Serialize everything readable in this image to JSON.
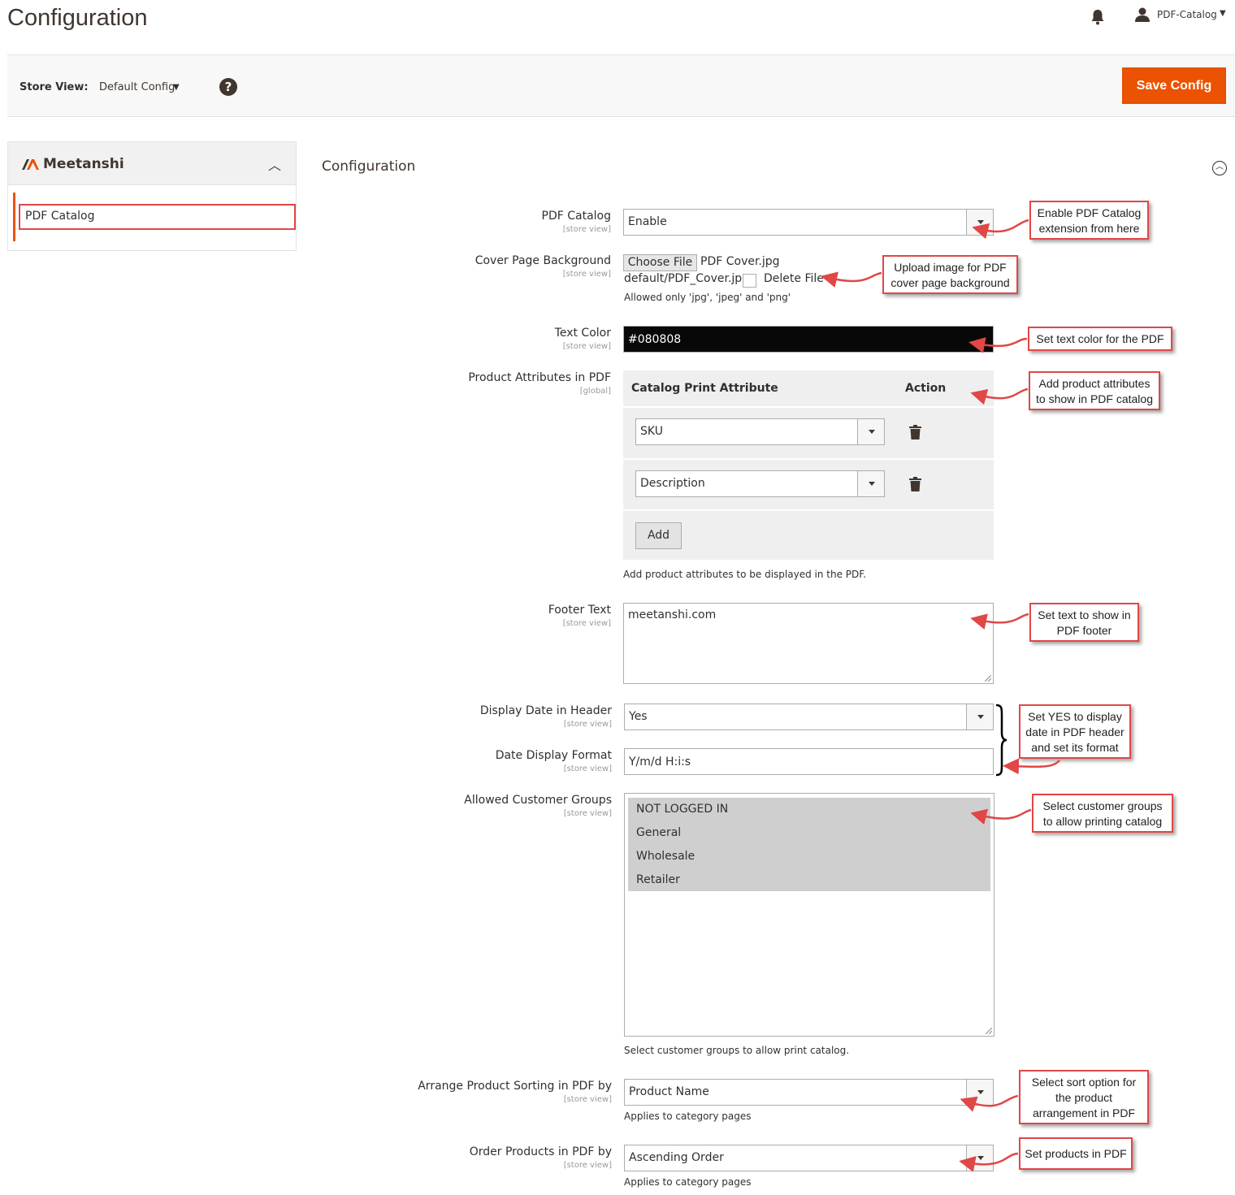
{
  "header": {
    "title": "Configuration",
    "user_name": "PDF-Catalog",
    "icons": [
      "bell-icon",
      "user-icon"
    ]
  },
  "store_bar": {
    "label": "Store View:",
    "value": "Default Config",
    "help": "?",
    "save_label": "Save Config"
  },
  "sidebar": {
    "brand": "Meetanshi",
    "items": [
      {
        "label": "PDF Catalog"
      }
    ]
  },
  "section": {
    "title": "Configuration"
  },
  "fields": {
    "pdf_catalog": {
      "label": "PDF Catalog",
      "scope": "[store view]",
      "value": "Enable"
    },
    "cover_page": {
      "label": "Cover Page Background",
      "scope": "[store view]",
      "button": "Choose File",
      "file_name": "PDF Cover.jpg",
      "current_path": "default/PDF_Cover.jpg",
      "delete_label": "Delete File",
      "note": "Allowed only 'jpg', 'jpeg' and 'png'"
    },
    "text_color": {
      "label": "Text Color",
      "scope": "[store view]",
      "value": "#080808"
    },
    "attributes": {
      "label": "Product Attributes in PDF",
      "scope": "[global]",
      "col_attribute": "Catalog Print Attribute",
      "col_action": "Action",
      "rows": [
        {
          "value": "SKU"
        },
        {
          "value": "Description"
        }
      ],
      "add_label": "Add",
      "note": "Add product attributes to be displayed in the PDF."
    },
    "footer_text": {
      "label": "Footer Text",
      "scope": "[store view]",
      "value": "meetanshi.com"
    },
    "display_date": {
      "label": "Display Date in Header",
      "scope": "[store view]",
      "value": "Yes"
    },
    "date_format": {
      "label": "Date Display Format",
      "scope": "[store view]",
      "value": "Y/m/d H:i:s"
    },
    "customer_groups": {
      "label": "Allowed Customer Groups",
      "scope": "[store view]",
      "options": [
        "NOT LOGGED IN",
        "General",
        "Wholesale",
        "Retailer"
      ],
      "note": "Select customer groups to allow print catalog."
    },
    "sorting": {
      "label": "Arrange Product Sorting in PDF by",
      "scope": "[store view]",
      "value": "Product Name",
      "note": "Applies to category pages"
    },
    "order": {
      "label": "Order Products in PDF by",
      "scope": "[store view]",
      "value": "Ascending Order",
      "note": "Applies to category pages"
    }
  },
  "callouts": {
    "enable": [
      "Enable PDF Catalog",
      "extension from here"
    ],
    "upload": [
      "Upload image for PDF",
      "cover page background"
    ],
    "color": [
      "Set text color for the PDF"
    ],
    "attributes": [
      "Add product attributes",
      "to show in PDF catalog"
    ],
    "footer": [
      "Set text to show in",
      "PDF footer"
    ],
    "date": [
      "Set YES to display",
      "date in PDF header",
      "and set its format"
    ],
    "groups": [
      "Select customer groups",
      "to allow printing catalog"
    ],
    "sort": [
      "Select sort option for",
      "the product",
      "arrangement in PDF"
    ],
    "order": [
      "Set products in PDF"
    ]
  },
  "colors": {
    "accent": "#eb5202",
    "callout_border": "#e04747",
    "text": "#303030"
  }
}
